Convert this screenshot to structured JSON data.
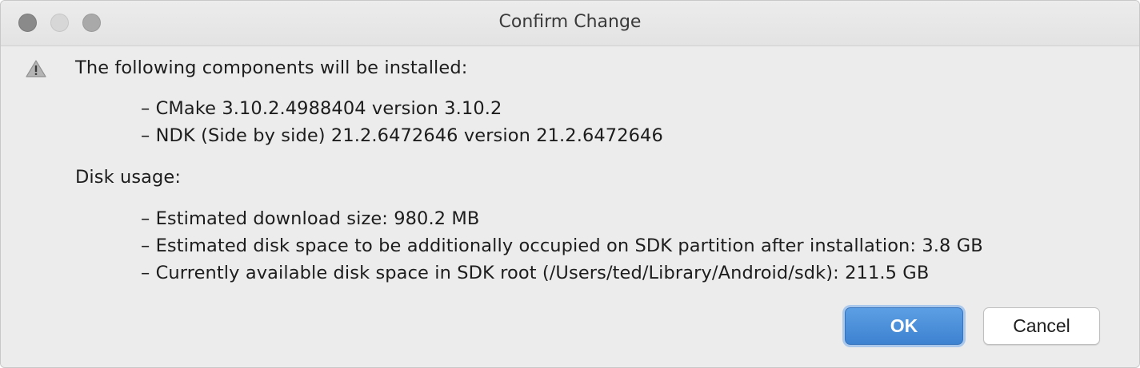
{
  "window": {
    "title": "Confirm Change"
  },
  "dialog": {
    "heading": "The following components will be installed:",
    "components": [
      "– CMake 3.10.2.4988404 version 3.10.2",
      "– NDK (Side by side) 21.2.6472646 version 21.2.6472646"
    ],
    "disk_heading": "Disk usage:",
    "disk_items": [
      "– Estimated download size: 980.2 MB",
      "– Estimated disk space to be additionally occupied on SDK partition after installation: 3.8 GB",
      "– Currently available disk space in SDK root (/Users/ted/Library/Android/sdk): 211.5 GB"
    ]
  },
  "buttons": {
    "ok_label": "OK",
    "cancel_label": "Cancel"
  },
  "icons": {
    "warning": "warning-icon"
  },
  "colors": {
    "accent": "#4a8fdb",
    "window_bg": "#ececec"
  }
}
